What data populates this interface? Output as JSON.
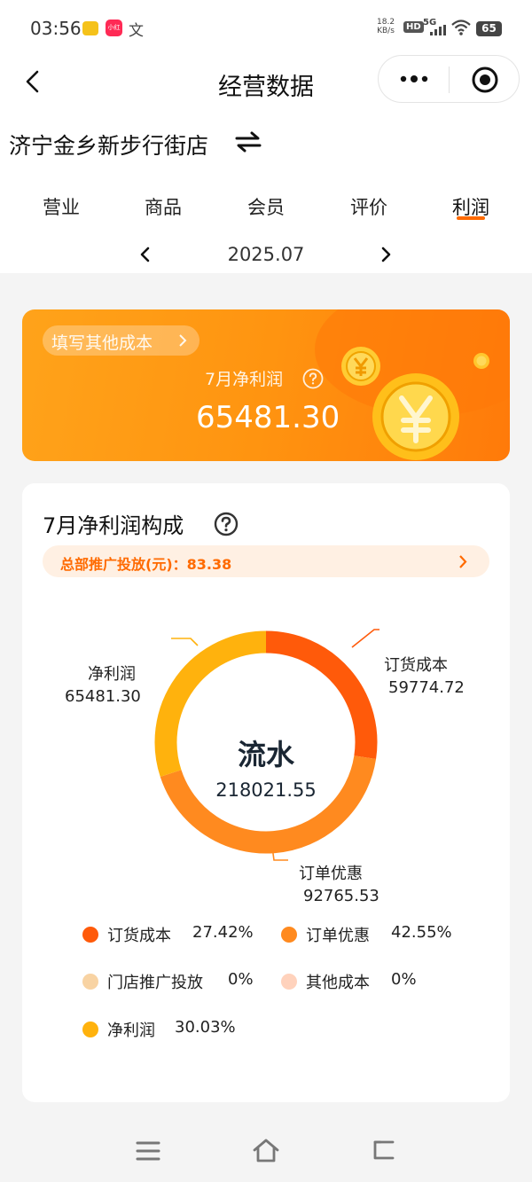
{
  "status_bar": {
    "time": "03:56",
    "app_badge": "小红书",
    "translate_glyph": "文",
    "net_speed_value": "18.2",
    "net_speed_unit": "KB/s",
    "hd_label": "HD",
    "signal_label": "5G",
    "battery": "65"
  },
  "nav": {
    "title": "经营数据"
  },
  "store": {
    "name": "济宁金乡新步行街店"
  },
  "tabs": [
    {
      "label": "营业"
    },
    {
      "label": "商品"
    },
    {
      "label": "会员"
    },
    {
      "label": "评价"
    },
    {
      "label": "利润",
      "active": true
    }
  ],
  "date": {
    "current": "2025.07"
  },
  "banner": {
    "fill_cost_label": "填写其他成本",
    "net_profit_label": "7月净利润",
    "net_profit_value": "65481.30"
  },
  "composition": {
    "title": "7月净利润构成",
    "promo_text": "总部推广投放(元)：83.38",
    "center_title": "流水",
    "center_value": "218021.55",
    "callouts": {
      "net_name": "净利润",
      "net_value": "65481.30",
      "order_name": "订货成本",
      "order_value": "59774.72",
      "discount_name": "订单优惠",
      "discount_value": "92765.53"
    },
    "legend": [
      {
        "name": "订货成本",
        "pct": "27.42%",
        "color": "#ff5a0a"
      },
      {
        "name": "订单优惠",
        "pct": "42.55%",
        "color": "#ff8a1f"
      },
      {
        "name": "门店推广投放",
        "pct": "0%",
        "color": "#f8d3a3"
      },
      {
        "name": "其他成本",
        "pct": "0%",
        "color": "#ffd2bc"
      },
      {
        "name": "净利润",
        "pct": "30.03%",
        "color": "#ffb20d"
      }
    ]
  },
  "chart_data": {
    "type": "pie",
    "title": "7月净利润构成",
    "center_label": "流水",
    "center_value": 218021.55,
    "categories": [
      "订货成本",
      "订单优惠",
      "门店推广投放",
      "其他成本",
      "净利润"
    ],
    "values": [
      59774.72,
      92765.53,
      0,
      0,
      65481.3
    ],
    "percentages": [
      27.42,
      42.55,
      0,
      0,
      30.03
    ],
    "colors": [
      "#ff5a0a",
      "#ff8a1f",
      "#f8d3a3",
      "#ffd2bc",
      "#ffb20d"
    ],
    "legend_position": "bottom"
  }
}
